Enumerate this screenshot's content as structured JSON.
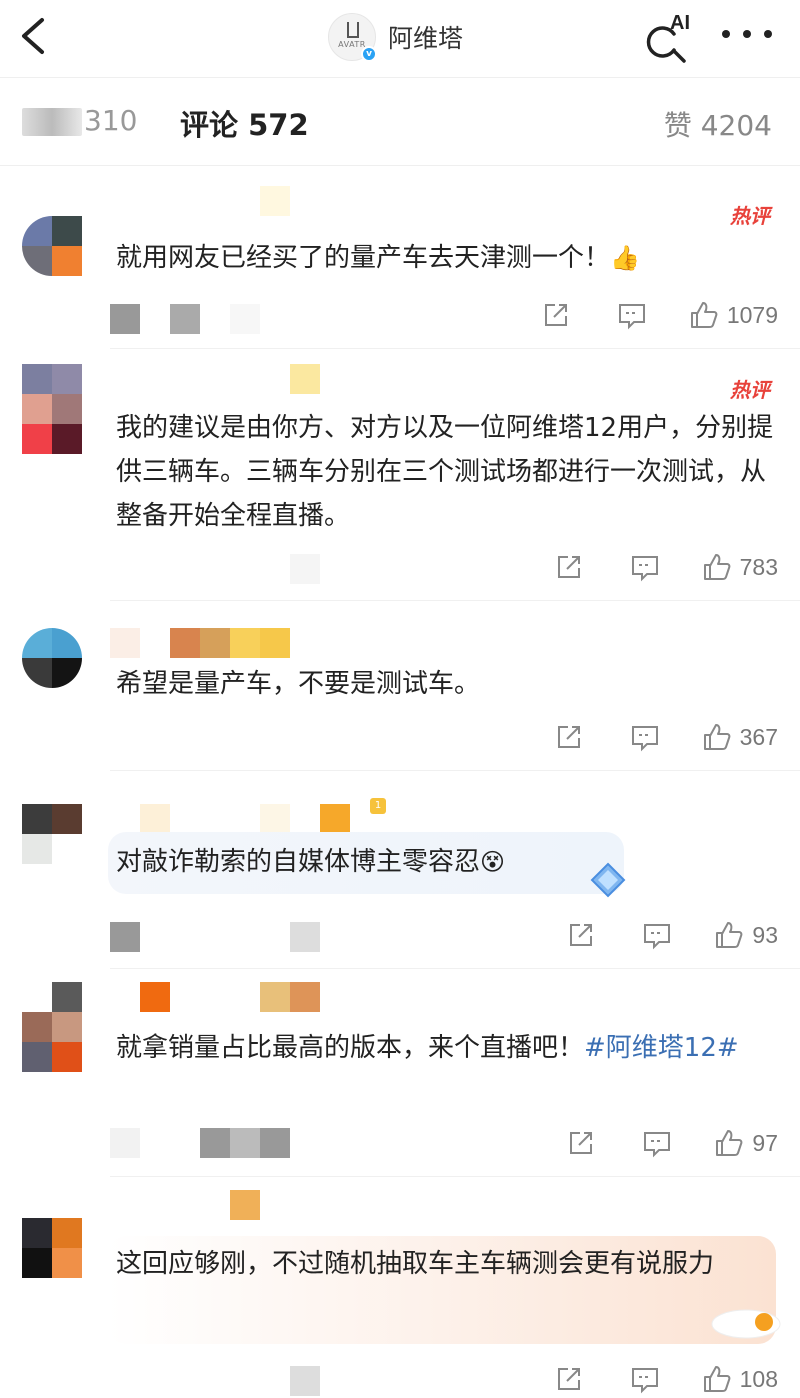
{
  "header": {
    "account_name": "阿维塔",
    "account_logo_text": "AVATR",
    "ai_label": "AI"
  },
  "tabs": {
    "repost": "310",
    "comments": "评论 572",
    "likes": "赞 4204"
  },
  "hot_label": "热评",
  "comments": [
    {
      "text": "就用网友已经买了的量产车去天津测一个！",
      "emoji": "👍",
      "likes": "1079",
      "hot": true
    },
    {
      "text": "我的建议是由你方、对方以及一位阿维塔12用户，分别提供三辆车。三辆车分别在三个测试场都进行一次测试，从整备开始全程直播。",
      "likes": "783",
      "hot": true
    },
    {
      "text": "希望是量产车，不要是测试车。",
      "likes": "367",
      "hot": false
    },
    {
      "text": "对敲诈勒索的自媒体博主零容忍",
      "emoji": "😵",
      "likes": "93",
      "hot": false
    },
    {
      "text": "就拿销量占比最高的版本，来个直播吧！",
      "topic": "#阿维塔12#",
      "likes": "97",
      "hot": false
    },
    {
      "text": "这回应够刚，不过随机抽取车主车辆测会更有说服力",
      "likes": "108",
      "hot": false
    }
  ]
}
